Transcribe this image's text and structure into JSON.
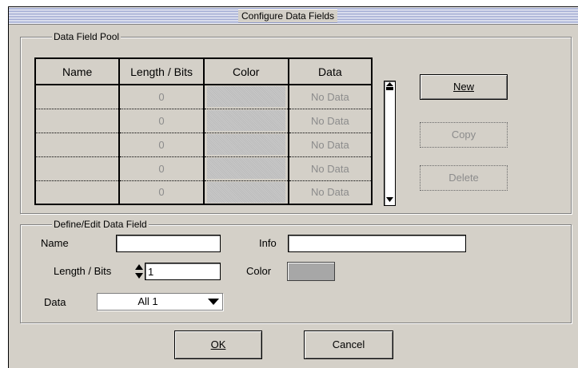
{
  "window": {
    "title": "Configure Data Fields"
  },
  "pool": {
    "legend": "Data Field Pool",
    "columns": [
      "Name",
      "Length / Bits",
      "Color",
      "Data"
    ],
    "rows": [
      {
        "name": "",
        "length": "0",
        "data": "No Data"
      },
      {
        "name": "",
        "length": "0",
        "data": "No Data"
      },
      {
        "name": "",
        "length": "0",
        "data": "No Data"
      },
      {
        "name": "",
        "length": "0",
        "data": "No Data"
      },
      {
        "name": "",
        "length": "0",
        "data": "No Data"
      }
    ],
    "buttons": {
      "new_label": "New",
      "copy_label": "Copy",
      "delete_label": "Delete"
    }
  },
  "edit": {
    "legend": "Define/Edit Data Field",
    "name_label": "Name",
    "name_value": "",
    "info_label": "Info",
    "info_value": "",
    "length_label": "Length / Bits",
    "length_value": "1",
    "color_label": "Color",
    "color_value": "#a7a7a7",
    "data_label": "Data",
    "data_value": "All 1"
  },
  "footer": {
    "ok_label": "OK",
    "cancel_label": "Cancel"
  },
  "colors": {
    "dialog_bg": "#d4d0c8",
    "disabled_text": "#8c8c8c",
    "swatch": "#a7a7a7"
  }
}
